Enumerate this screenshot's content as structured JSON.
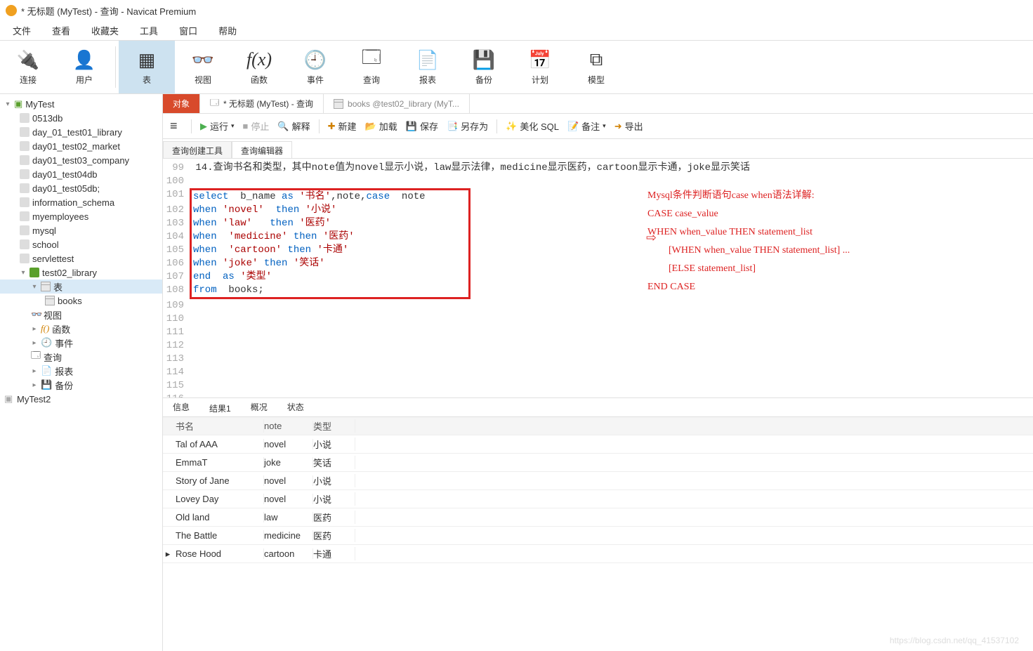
{
  "window": {
    "title": "* 无标题 (MyTest) - 查询 - Navicat Premium"
  },
  "menu": [
    "文件",
    "查看",
    "收藏夹",
    "工具",
    "窗口",
    "帮助"
  ],
  "toolbar": [
    {
      "label": "连接",
      "icon": "🔌"
    },
    {
      "label": "用户",
      "icon": "👤"
    },
    {
      "label": "表",
      "icon": "▦",
      "active": true
    },
    {
      "label": "视图",
      "icon": "👓"
    },
    {
      "label": "函数",
      "icon": "f(x)"
    },
    {
      "label": "事件",
      "icon": "🕘"
    },
    {
      "label": "查询",
      "icon": "🗔"
    },
    {
      "label": "报表",
      "icon": "📄"
    },
    {
      "label": "备份",
      "icon": "💾"
    },
    {
      "label": "计划",
      "icon": "📅"
    },
    {
      "label": "模型",
      "icon": "⧉"
    }
  ],
  "tree": {
    "root": "MyTest",
    "dbs": [
      "0513db",
      "day_01_test01_library",
      "day01_test02_market",
      "day01_test03_company",
      "day01_test04db",
      "day01_test05db;",
      "information_schema",
      "myemployees",
      "mysql",
      "school",
      "servlettest"
    ],
    "openDb": "test02_library",
    "openDbChildren": {
      "tables_label": "表",
      "books": "books",
      "view": "视图",
      "func": "函数",
      "event": "事件",
      "query": "查询",
      "report": "报表",
      "backup": "备份"
    },
    "root2": "MyTest2"
  },
  "tabs": {
    "obj": "对象",
    "q": "* 无标题 (MyTest) - 查询",
    "books": "books @test02_library (MyT..."
  },
  "qtb": {
    "run": "运行",
    "stop": "停止",
    "explain": "解释",
    "new": "新建",
    "load": "加载",
    "save": "保存",
    "saveas": "另存为",
    "beautify": "美化 SQL",
    "note": "备注",
    "export": "导出"
  },
  "subtabs": {
    "builder": "查询创建工具",
    "editor": "查询编辑器"
  },
  "editor": {
    "startLine": 99,
    "comment": "14.查询书名和类型，其中note值为novel显示小说，law显示法律，medicine显示医药，cartoon显示卡通，joke显示笑话",
    "sql": [
      "select  b_name as '书名',note,case  note",
      "when 'novel'  then '小说'",
      "when 'law'   then '医药'",
      "when  'medicine' then '医药'",
      "when  'cartoon' then '卡通'",
      "when 'joke' then '笑话'",
      "end  as '类型'",
      "from  books;"
    ]
  },
  "annotation": {
    "l1": "Mysql条件判断语句case when语法详解:",
    "l2": "CASE case_value",
    "l3": "WHEN when_value THEN statement_list",
    "l4": "[WHEN when_value THEN statement_list] ...",
    "l5": "[ELSE statement_list]",
    "l6": "END CASE"
  },
  "resTabs": [
    "信息",
    "结果1",
    "概况",
    "状态"
  ],
  "grid": {
    "headers": [
      "书名",
      "note",
      "类型"
    ],
    "rows": [
      [
        "Tal of AAA",
        "novel",
        "小说"
      ],
      [
        "EmmaT",
        "joke",
        "笑话"
      ],
      [
        "Story of Jane",
        "novel",
        "小说"
      ],
      [
        "Lovey Day",
        "novel",
        "小说"
      ],
      [
        "Old land",
        "law",
        "医药"
      ],
      [
        "The Battle",
        "medicine",
        "医药"
      ],
      [
        "Rose Hood",
        "cartoon",
        "卡通"
      ]
    ],
    "currentRow": 6
  },
  "watermark": "https://blog.csdn.net/qq_41537102"
}
